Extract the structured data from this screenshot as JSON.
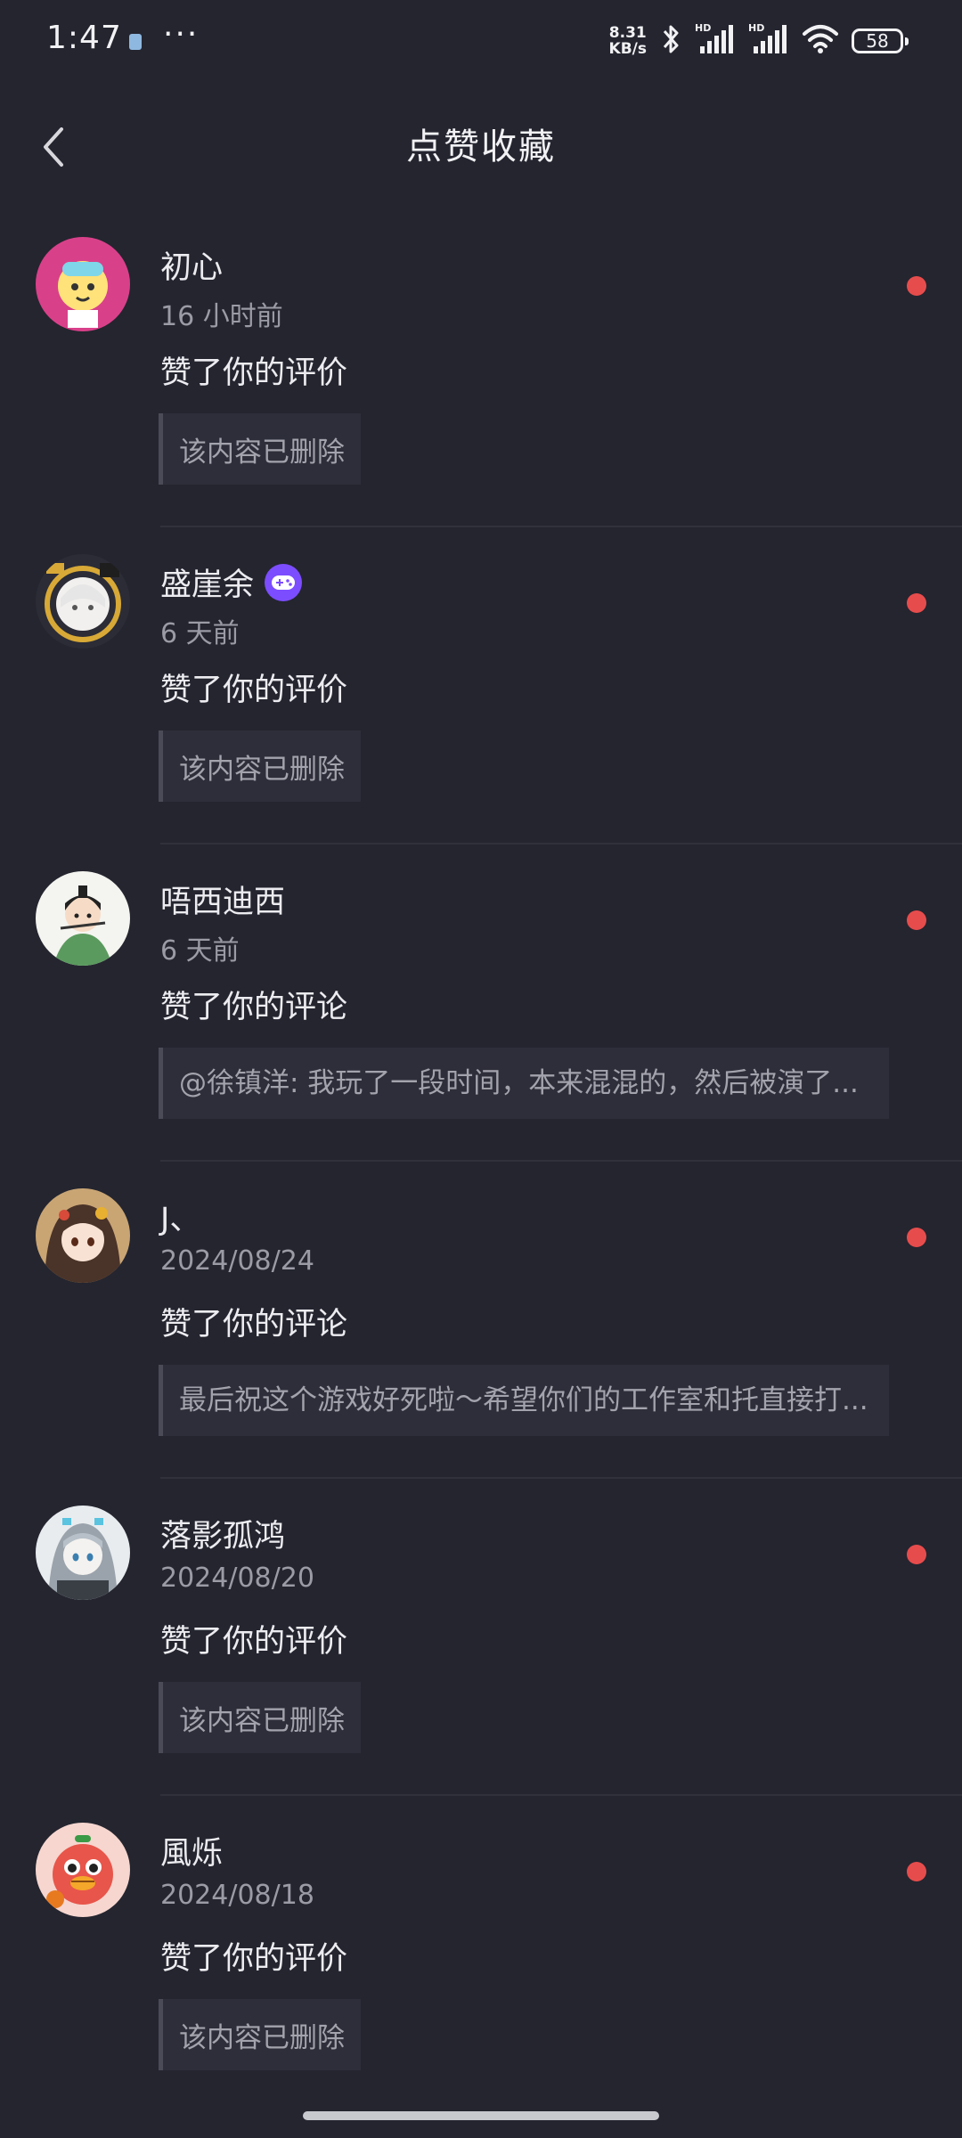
{
  "status_bar": {
    "time": "1:47",
    "more": "···",
    "net_speed_value": "8.31",
    "net_speed_unit": "KB/s",
    "battery": "58",
    "icons": [
      "bluetooth-icon",
      "signal-hd-icon",
      "signal-hd-icon",
      "wifi-icon",
      "battery-icon"
    ]
  },
  "header": {
    "title": "点赞收藏",
    "back_icon": "chevron-left-icon"
  },
  "notifications": [
    {
      "name": "初心",
      "time": "16 小时前",
      "action": "赞了你的评价",
      "quote": "该内容已删除",
      "unread": true,
      "badge": null
    },
    {
      "name": "盛崖余",
      "time": "6 天前",
      "action": "赞了你的评价",
      "quote": "该内容已删除",
      "unread": true,
      "badge": "gamepad-icon"
    },
    {
      "name": "唔西迪西",
      "time": "6 天前",
      "action": "赞了你的评论",
      "quote": "@徐镇洋: 我玩了一段时间，本来混混的，然后被演了...",
      "unread": true,
      "badge": null
    },
    {
      "name": "J、",
      "time": "2024/08/24",
      "action": "赞了你的评论",
      "quote": "最后祝这个游戏好死啦～希望你们的工作室和托直接打...",
      "unread": true,
      "badge": null
    },
    {
      "name": "落影孤鸿",
      "time": "2024/08/20",
      "action": "赞了你的评价",
      "quote": "该内容已删除",
      "unread": true,
      "badge": null
    },
    {
      "name": "風烁",
      "time": "2024/08/18",
      "action": "赞了你的评价",
      "quote": "该内容已删除",
      "unread": true,
      "badge": null
    }
  ],
  "colors": {
    "background": "#24252f",
    "unread_dot": "#e74c4c",
    "badge": "#7c4dff"
  }
}
